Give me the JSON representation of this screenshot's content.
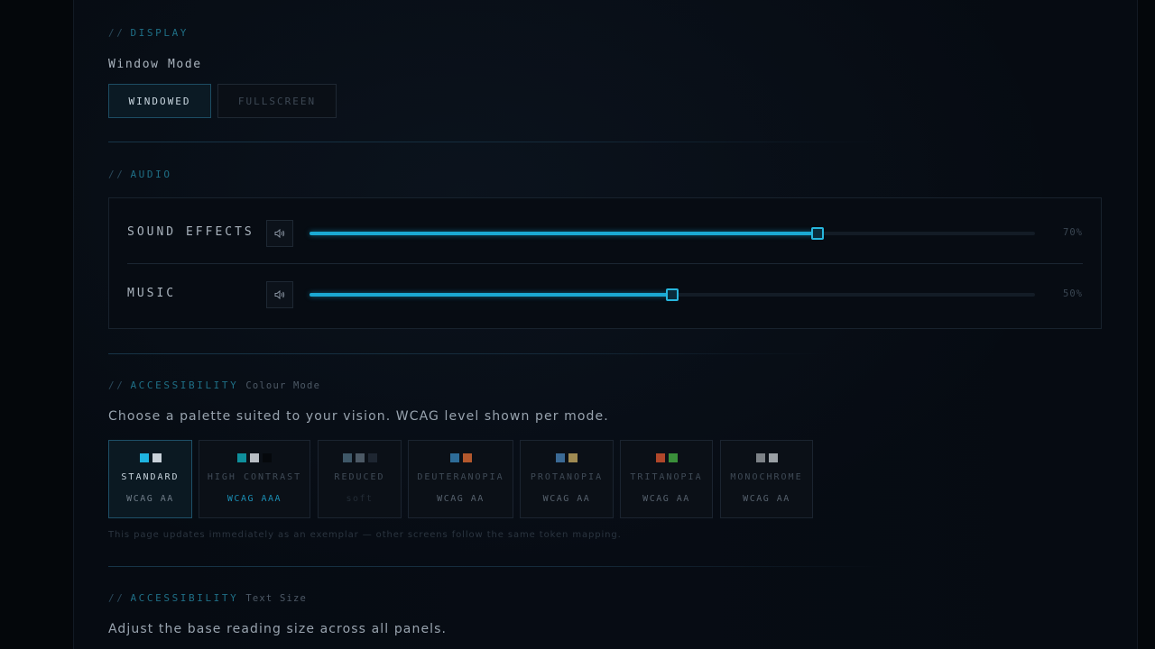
{
  "display": {
    "section_prefix": "//",
    "section_title": "DISPLAY",
    "window_mode_label": "Window Mode",
    "modes": [
      {
        "label": "WINDOWED",
        "active": true
      },
      {
        "label": "FULLSCREEN",
        "active": false
      }
    ]
  },
  "audio": {
    "section_prefix": "//",
    "section_title": "AUDIO",
    "channels": [
      {
        "name": "SOUND EFFECTS",
        "value": 70,
        "value_label": "70%",
        "icon": "speaker-icon"
      },
      {
        "name": "MUSIC",
        "value": 50,
        "value_label": "50%",
        "icon": "speaker-icon"
      }
    ]
  },
  "colour": {
    "section_prefix": "//",
    "section_title": "ACCESSIBILITY",
    "section_sub": "Colour Mode",
    "description": "Choose a palette suited to your vision. WCAG level shown per mode.",
    "palettes": [
      {
        "name": "STANDARD",
        "level": "WCAG AA",
        "colors": [
          "#1fb4e0",
          "#c9d2da"
        ],
        "active": true
      },
      {
        "name": "HIGH CONTRAST",
        "level": "WCAG AAA",
        "colors": [
          "#0f8f9c",
          "#b8bec4",
          "#05080c"
        ],
        "active": false
      },
      {
        "name": "REDUCED",
        "level": "soft",
        "colors": [
          "#3f5868",
          "#4c5965",
          "#1e2631"
        ],
        "active": false
      },
      {
        "name": "DEUTERANOPIA",
        "level": "WCAG AA",
        "colors": [
          "#2e6c98",
          "#b3582d"
        ],
        "active": false
      },
      {
        "name": "PROTANOPIA",
        "level": "WCAG AA",
        "colors": [
          "#3b6a95",
          "#9f8a52"
        ],
        "active": false
      },
      {
        "name": "TRITANOPIA",
        "level": "WCAG AA",
        "colors": [
          "#b0472a",
          "#3a8f3a"
        ],
        "active": false
      },
      {
        "name": "MONOCHROME",
        "level": "WCAG AA",
        "colors": [
          "#7d8287",
          "#9aa0a5"
        ],
        "active": false
      }
    ],
    "footnote": "This page updates immediately as an exemplar — other screens follow the same token mapping."
  },
  "text_size": {
    "section_prefix": "//",
    "section_title": "ACCESSIBILITY",
    "section_sub": "Text Size",
    "description": "Adjust the base reading size across all panels."
  },
  "colors": {
    "accent": "#1ba9d3",
    "background": "#060b12"
  }
}
